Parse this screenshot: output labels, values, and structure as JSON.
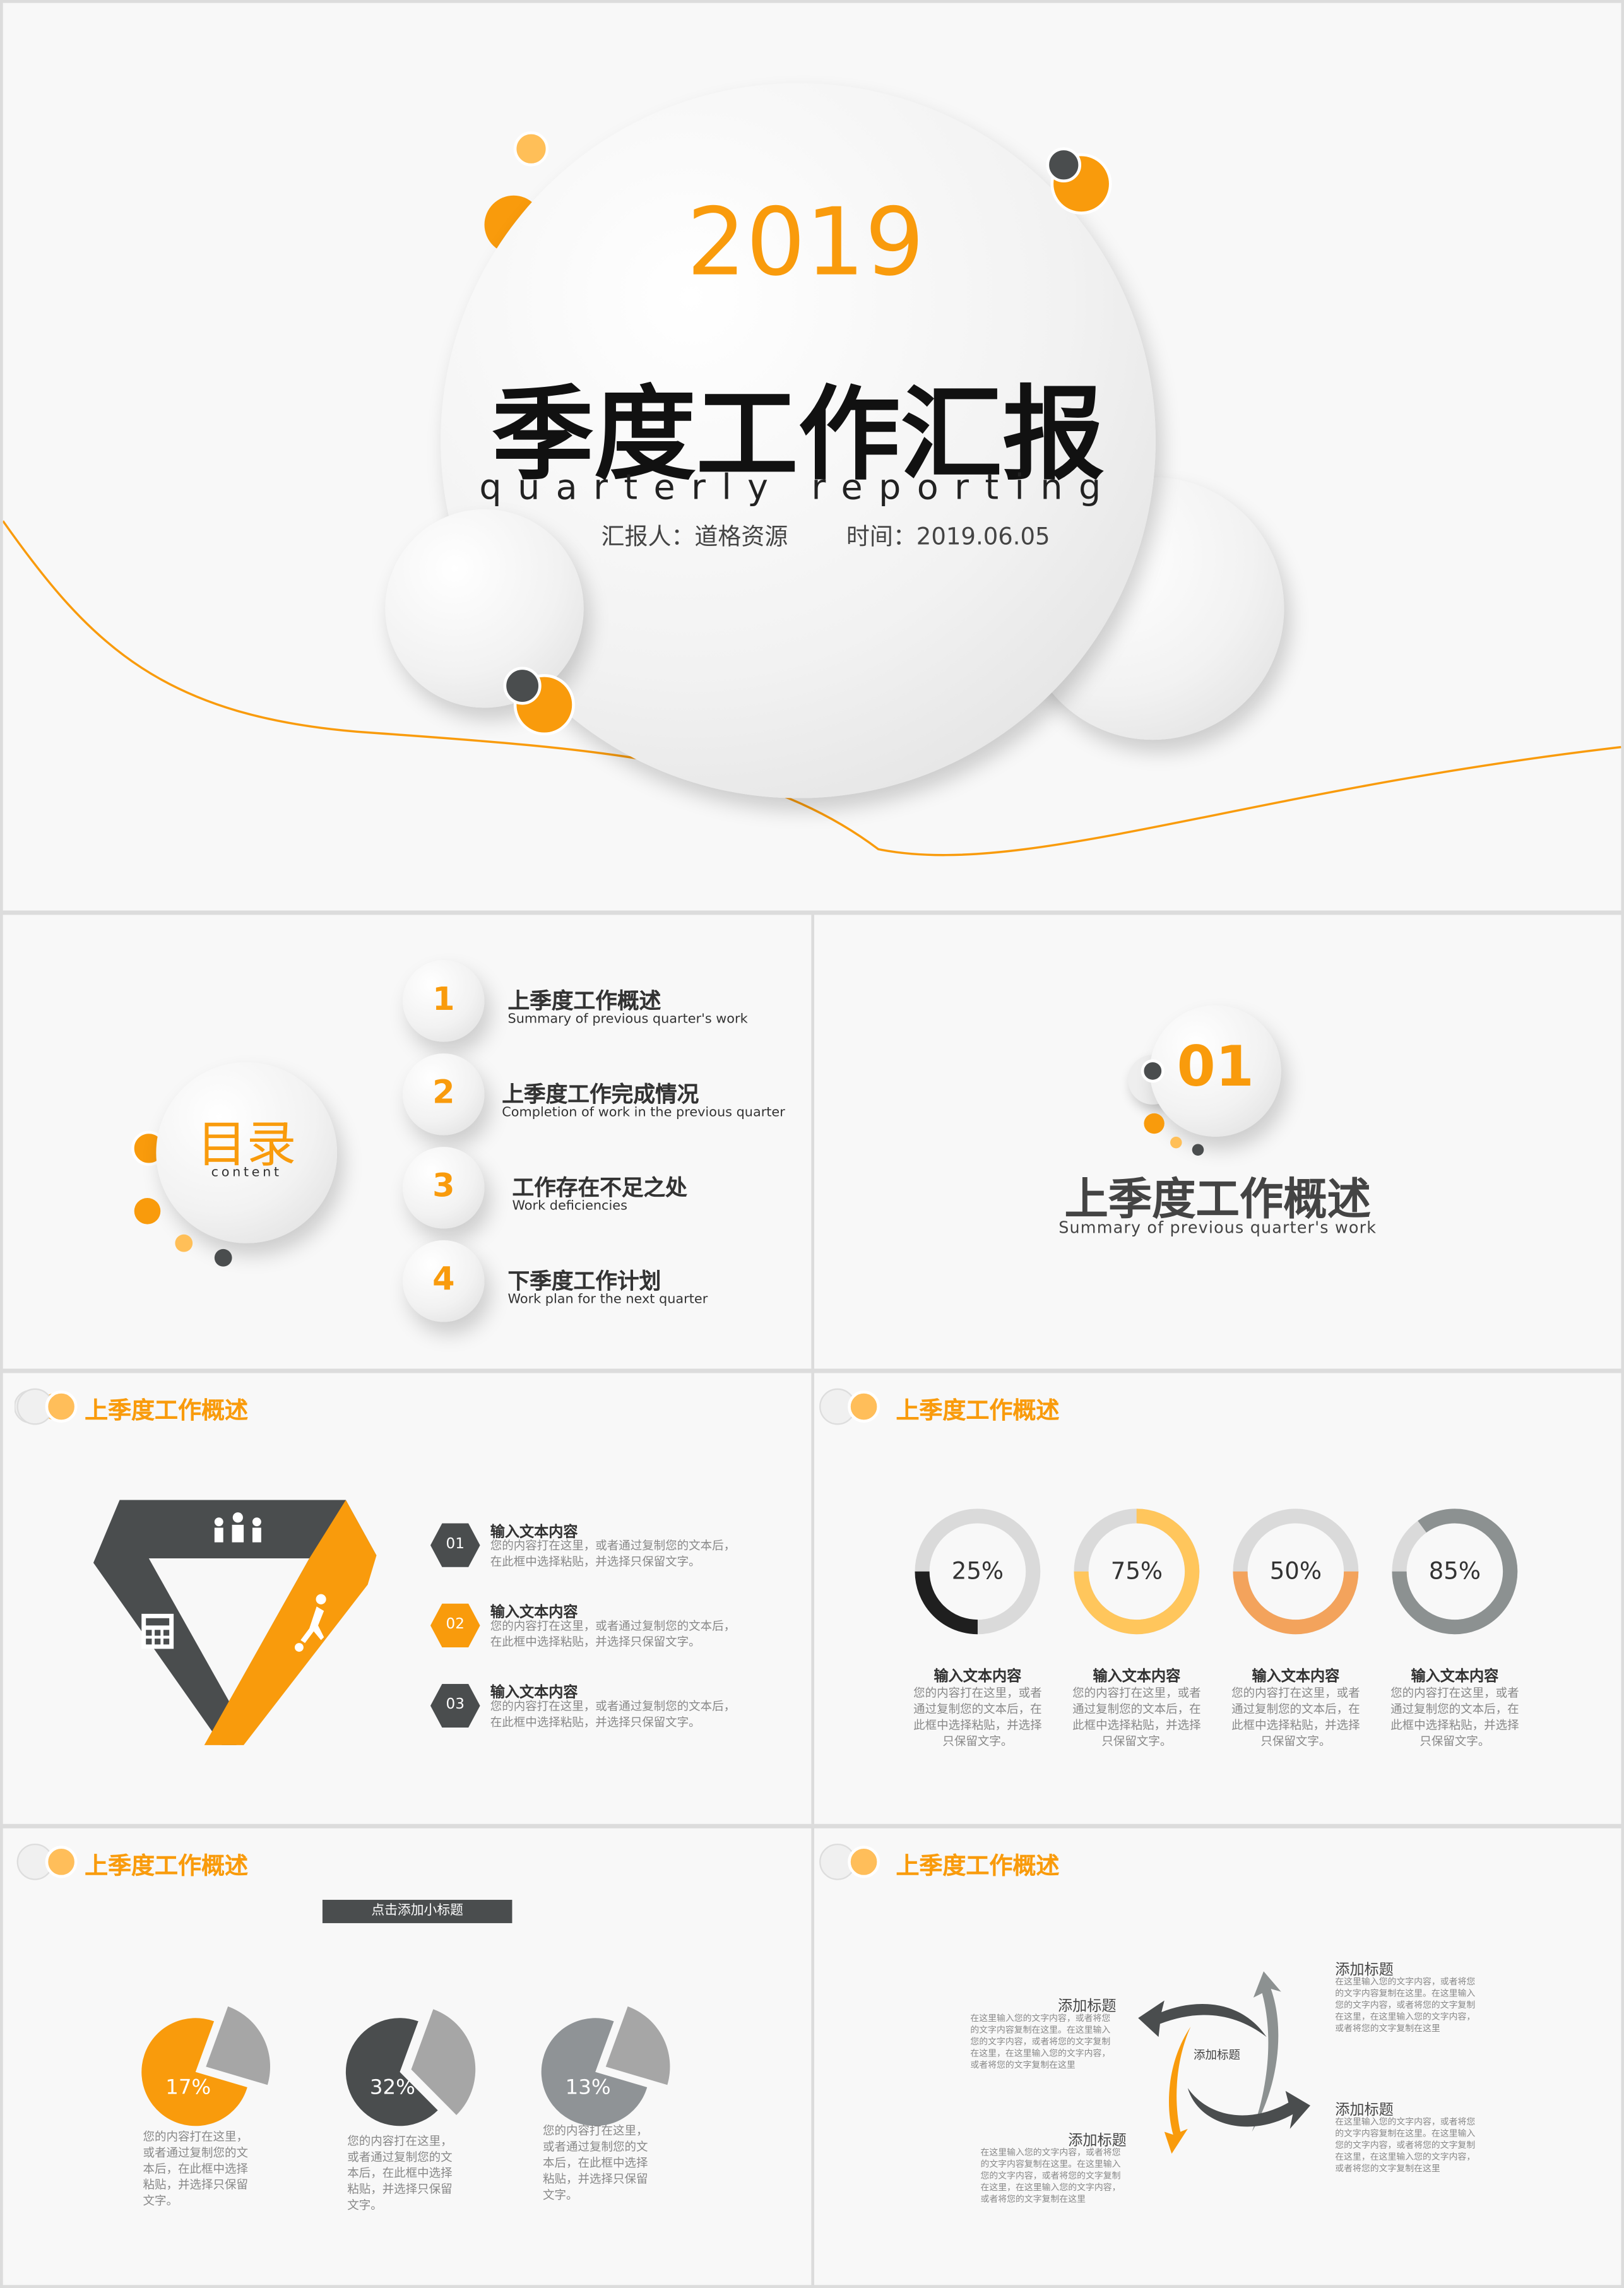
{
  "colors": {
    "accent": "#f99b0c",
    "dark": "#4a4d4e",
    "gray": "#a6a6a6"
  },
  "cover": {
    "year": "2019",
    "title": "季度工作汇报",
    "subtitle": "quarterly reporting",
    "reporter": "汇报人：道格资源",
    "time": "时间：2019.06.05"
  },
  "toc": {
    "title": "目录",
    "subtitle": "content",
    "items": [
      {
        "num": "1",
        "title": "上季度工作概述",
        "sub": "Summary of previous quarter's work"
      },
      {
        "num": "2",
        "title": "上季度工作完成情况",
        "sub": "Completion of work in the previous quarter"
      },
      {
        "num": "3",
        "title": "工作存在不足之处",
        "sub": "Work deficiencies"
      },
      {
        "num": "4",
        "title": "下季度工作计划",
        "sub": "Work plan for the next quarter"
      }
    ]
  },
  "section": {
    "num": "01",
    "title": "上季度工作概述",
    "sub": "Summary of previous quarter's work"
  },
  "slide3": {
    "header": "上季度工作概述",
    "icons": [
      "family-icon",
      "calculator-icon",
      "soccer-player-icon"
    ],
    "items": [
      {
        "num": "01",
        "title": "输入文本内容",
        "text": "您的内容打在这里，或者通过复制您的文本后，在此框中选择粘贴，并选择只保留文字。",
        "color": "#4a4d4e"
      },
      {
        "num": "02",
        "title": "输入文本内容",
        "text": "您的内容打在这里，或者通过复制您的文本后，在此框中选择粘贴，并选择只保留文字。",
        "color": "#f99b0c"
      },
      {
        "num": "03",
        "title": "输入文本内容",
        "text": "您的内容打在这里，或者通过复制您的文本后，在此框中选择粘贴，并选择只保留文字。",
        "color": "#4a4d4e"
      }
    ]
  },
  "slide4": {
    "header": "上季度工作概述",
    "donuts": [
      {
        "label": "25%",
        "value": 25,
        "color": "#1f1f1f",
        "title": "输入文本内容",
        "text": "您的内容打在这里，或者通过复制您的文本后，在此框中选择粘贴，并选择只保留文字。"
      },
      {
        "label": "75%",
        "value": 75,
        "color": "#ffc65c",
        "title": "输入文本内容",
        "text": "您的内容打在这里，或者通过复制您的文本后，在此框中选择粘贴，并选择只保留文字。"
      },
      {
        "label": "50%",
        "value": 50,
        "color": "#f3a35c",
        "title": "输入文本内容",
        "text": "您的内容打在这里，或者通过复制您的文本后，在此框中选择粘贴，并选择只保留文字。"
      },
      {
        "label": "85%",
        "value": 85,
        "color": "#8c9191",
        "title": "输入文本内容",
        "text": "您的内容打在这里，或者通过复制您的文本后，在此框中选择粘贴，并选择只保留文字。"
      }
    ]
  },
  "slide5": {
    "header": "上季度工作概述",
    "subtitle_button": "点击添加小标题",
    "pies": [
      {
        "label": "17%",
        "value": 17,
        "color": "#f99b0c",
        "text": "您的内容打在这里，或者通过复制您的文本后，在此框中选择粘贴，并选择只保留文字。"
      },
      {
        "label": "32%",
        "value": 32,
        "color": "#4a4d4e",
        "text": "您的内容打在这里，或者通过复制您的文本后，在此框中选择粘贴，并选择只保留文字。"
      },
      {
        "label": "13%",
        "value": 13,
        "color": "#8f9396",
        "text": "您的内容打在这里，或者通过复制您的文本后，在此框中选择粘贴，并选择只保留文字。"
      }
    ]
  },
  "slide6": {
    "header": "上季度工作概述",
    "center": "添加标题",
    "blocks": [
      {
        "title": "添加标题",
        "text": "在这里输入您的文字内容，或者将您的文字内容复制在这里。在这里输入您的文字内容，或者将您的文字复制在这里，在这里输入您的文字内容，或者将您的文字复制在这里"
      },
      {
        "title": "添加标题",
        "text": "在这里输入您的文字内容，或者将您的文字内容复制在这里。在这里输入您的文字内容，或者将您的文字复制在这里，在这里输入您的文字内容，或者将您的文字复制在这里"
      },
      {
        "title": "添加标题",
        "text": "在这里输入您的文字内容，或者将您的文字内容复制在这里。在这里输入您的文字内容，或者将您的文字复制在这里，在这里输入您的文字内容，或者将您的文字复制在这里"
      },
      {
        "title": "添加标题",
        "text": "在这里输入您的文字内容，或者将您的文字内容复制在这里。在这里输入您的文字内容，或者将您的文字复制在这里，在这里输入您的文字内容，或者将您的文字复制在这里"
      }
    ]
  }
}
